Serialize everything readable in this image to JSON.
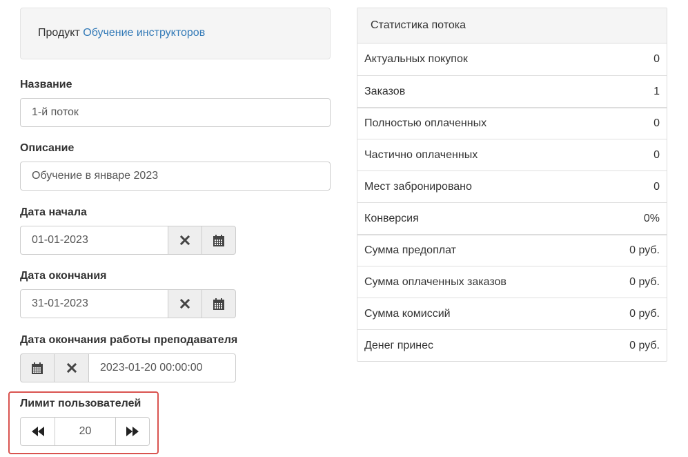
{
  "product": {
    "label": "Продукт",
    "name": "Обучение инструкторов"
  },
  "form": {
    "name": {
      "label": "Название",
      "value": "1-й поток"
    },
    "description": {
      "label": "Описание",
      "value": "Обучение в январе 2023"
    },
    "start_date": {
      "label": "Дата начала",
      "value": "01-01-2023"
    },
    "end_date": {
      "label": "Дата окончания",
      "value": "31-01-2023"
    },
    "teacher_end": {
      "label": "Дата окончания работы преподавателя",
      "value": "2023-01-20 00:00:00"
    },
    "user_limit": {
      "label": "Лимит пользователей",
      "value": "20"
    }
  },
  "icons": {
    "clear": "close-icon",
    "calendar": "calendar-icon",
    "decrement": "fast-backward-icon",
    "increment": "fast-forward-icon"
  },
  "stats": {
    "title": "Статистика потока",
    "rows": [
      {
        "label": "Актуальных покупок",
        "value": "0"
      },
      {
        "label": "Заказов",
        "value": "1"
      },
      {
        "label": "Полностью оплаченных",
        "value": "0"
      },
      {
        "label": "Частично оплаченных",
        "value": "0"
      },
      {
        "label": "Мест забронировано",
        "value": "0"
      },
      {
        "label": "Конверсия",
        "value": "0%"
      },
      {
        "label": "Сумма предоплат",
        "value": "0 руб."
      },
      {
        "label": "Сумма оплаченных заказов",
        "value": "0 руб."
      },
      {
        "label": "Сумма комиссий",
        "value": "0 руб."
      },
      {
        "label": "Денег принес",
        "value": "0 руб."
      }
    ]
  },
  "colors": {
    "link": "#337ab7",
    "highlight": "#d9534f"
  }
}
